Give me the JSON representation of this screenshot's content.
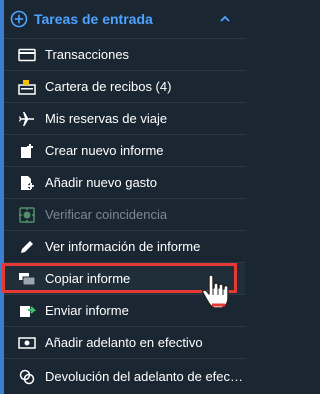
{
  "header": {
    "title": "Tareas de entrada",
    "plus_icon": "plus-circle-icon",
    "chevron_icon": "chevron-up-icon",
    "accent_color": "#4da3ff"
  },
  "menu": {
    "items": [
      {
        "label": "Transacciones",
        "icon": "credit-card-icon",
        "state": "normal"
      },
      {
        "label": "Cartera de recibos (4)",
        "icon": "receipt-wallet-icon",
        "state": "normal"
      },
      {
        "label": "Mis reservas de viaje",
        "icon": "airplane-icon",
        "state": "normal"
      },
      {
        "label": "Crear nuevo informe",
        "icon": "new-report-icon",
        "state": "normal"
      },
      {
        "label": "Añadir nuevo gasto",
        "icon": "add-expense-icon",
        "state": "normal"
      },
      {
        "label": "Verificar coincidencia",
        "icon": "verify-match-icon",
        "state": "disabled"
      },
      {
        "label": "Ver información de informe",
        "icon": "pencil-icon",
        "state": "normal"
      },
      {
        "label": "Copiar informe",
        "icon": "copy-icon",
        "state": "highlighted"
      },
      {
        "label": "Enviar informe",
        "icon": "send-report-icon",
        "state": "normal"
      },
      {
        "label": "Añadir adelanto en efectivo",
        "icon": "cash-icon",
        "state": "normal"
      },
      {
        "label": "Devolución del adelanto de efectivo",
        "icon": "cash-return-icon",
        "state": "normal"
      }
    ]
  },
  "colors": {
    "background": "#1a2733",
    "left_bar": "#3b7fd4",
    "highlight_border": "#e53935",
    "disabled_text": "#7b8894"
  }
}
